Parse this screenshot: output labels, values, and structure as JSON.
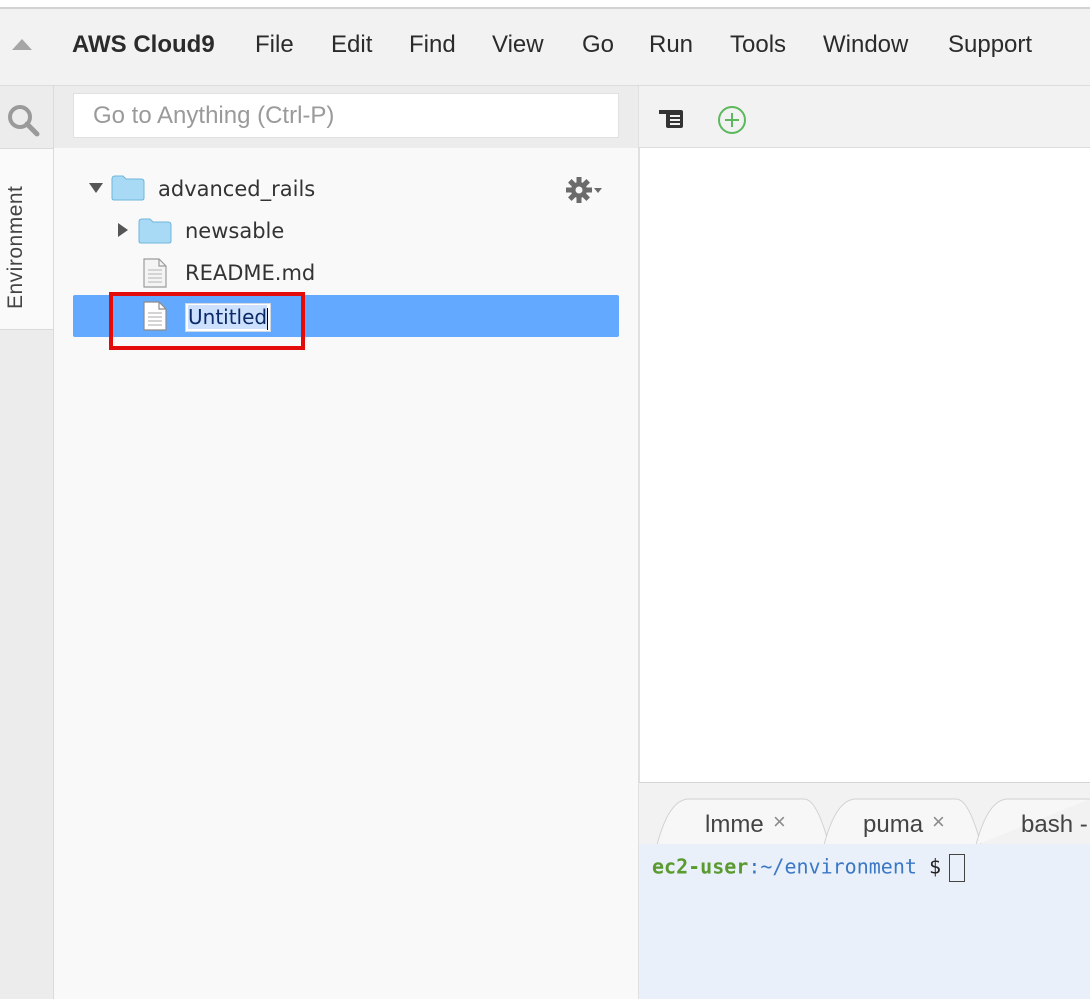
{
  "menubar": {
    "brand": "AWS Cloud9",
    "items": [
      "File",
      "Edit",
      "Find",
      "View",
      "Go",
      "Run",
      "Tools",
      "Window",
      "Support"
    ]
  },
  "sidebar": {
    "env_tab_label": "Environment",
    "goto_placeholder": "Go to Anything (Ctrl-P)"
  },
  "tree": {
    "root": "advanced_rails",
    "children": [
      {
        "type": "folder",
        "name": "newsable"
      },
      {
        "type": "file",
        "name": "README.md"
      },
      {
        "type": "file",
        "name": "Untitled",
        "state": "renaming"
      }
    ]
  },
  "terminal": {
    "tabs": [
      "lmme",
      "puma",
      "bash -"
    ],
    "prompt_user": "ec2-user",
    "prompt_path": ":~/environment",
    "prompt_symbol": " $"
  },
  "colors": {
    "selection": "#63a9ff",
    "highlight_box": "#e40b0b",
    "folder": "#a8daf5",
    "add_icon": "#5cb85c"
  }
}
